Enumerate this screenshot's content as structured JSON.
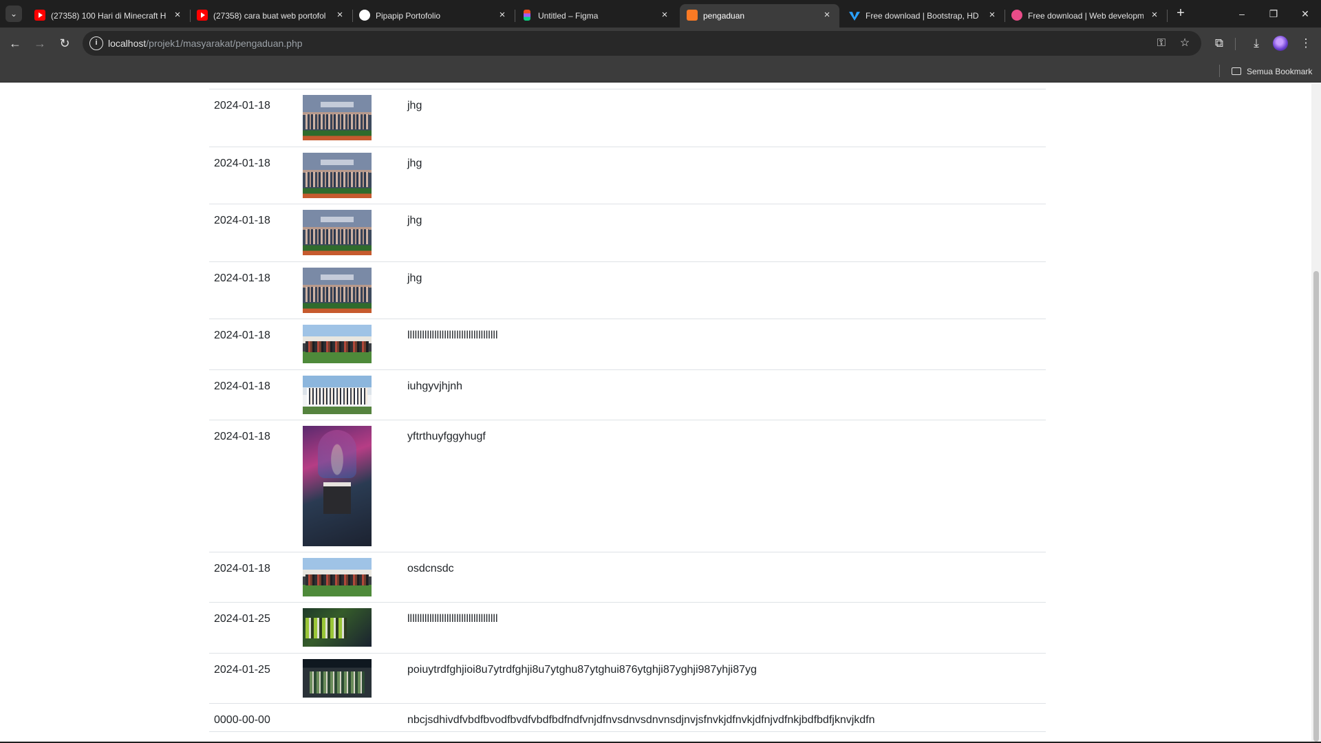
{
  "browser": {
    "tabs": [
      {
        "title": "(27358) 100 Hari di Minecraft H",
        "favicon": "youtube-icon"
      },
      {
        "title": "(27358) cara buat web portofol",
        "favicon": "youtube-icon"
      },
      {
        "title": "Pipapip Portofolio",
        "favicon": "github-icon"
      },
      {
        "title": "Untitled – Figma",
        "favicon": "figma-icon"
      },
      {
        "title": "pengaduan",
        "favicon": "xampp-icon",
        "active": true
      },
      {
        "title": "Free download | Bootstrap, HD",
        "favicon": "bootstrap-icon"
      },
      {
        "title": "Free download | Web developm",
        "favicon": "dribbble-icon"
      }
    ],
    "url_host": "localhost",
    "url_path": "/projek1/masyarakat/pengaduan.php",
    "bookmarks_folder": "Semua Bookmark"
  },
  "table": {
    "rows": [
      {
        "date": "2024-01-18",
        "image": "group-photo",
        "text": "jhg"
      },
      {
        "date": "2024-01-18",
        "image": "group-photo",
        "text": "jhg"
      },
      {
        "date": "2024-01-18",
        "image": "group-photo",
        "text": "jhg"
      },
      {
        "date": "2024-01-18",
        "image": "group-photo",
        "text": "jhg"
      },
      {
        "date": "2024-01-18",
        "image": "field-photo",
        "text": "lllllllllllllllllllllllllllllllllllll"
      },
      {
        "date": "2024-01-18",
        "image": "white-uniform-photo",
        "text": "iuhgyvjhjnh"
      },
      {
        "date": "2024-01-18",
        "image": "portrait-photo",
        "text": "yftrthuyfggyhugf"
      },
      {
        "date": "2024-01-18",
        "image": "field-photo",
        "text": "osdcnsdc"
      },
      {
        "date": "2024-01-25",
        "image": "green-photo",
        "text": "lllllllllllllllllllllllllllllllllllll"
      },
      {
        "date": "2024-01-25",
        "image": "dark-photo",
        "text": "poiuytrdfghjioi8u7ytrdfghji8u7ytghu87ytghui876ytghji87yghji987yhji87yg"
      },
      {
        "date": "0000-00-00",
        "image": "",
        "text": "nbcjsdhivdfvbdfbvodfbvdfvbdfbdfndfvnjdfnvsdnvsdnvnsdjnvjsfnvkjdfnvkjdfnjvdfnkjbdfbdfjknvjkdfn"
      }
    ]
  }
}
